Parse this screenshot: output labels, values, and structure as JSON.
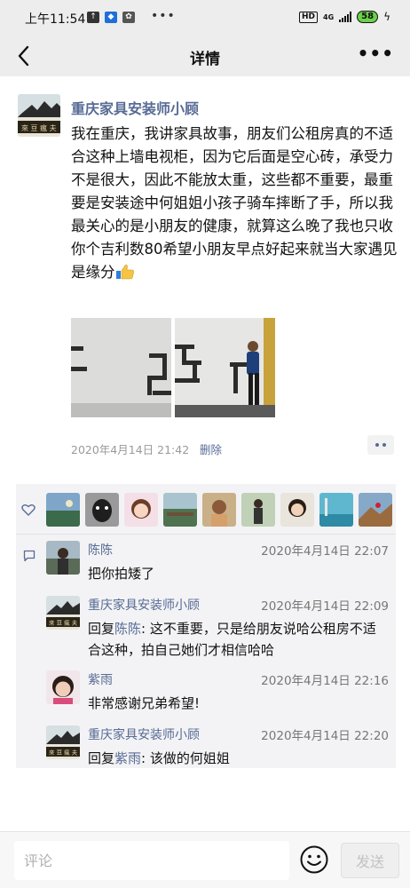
{
  "status_bar": {
    "time": "上午11:54",
    "hd": "HD",
    "network": "4G",
    "battery": "58"
  },
  "nav": {
    "title": "详情",
    "back_icon": "chevron-left-icon",
    "more_icon": "more-dots-icon"
  },
  "post": {
    "author": "重庆家具安装师小顾",
    "text": "我在重庆，我讲家具故事，朋友们公租房真的不适合这种上墙电视柜，因为它后面是空心砖，承受力不是很大，因此不能放太重，这些都不重要，最重要是安装途中何姐姐小孩子骑车摔断了手，所以我最关心的是小朋友的健康，就算这么晚了我也只收你个吉利数80希望小朋友早点好起来就当大家遇见是缘分",
    "emoji": "thumbs-up-icon",
    "time": "2020年4月14日 21:42",
    "delete_label": "删除"
  },
  "likes": {
    "icon": "heart-outline-icon",
    "count_avatars": 9
  },
  "comments": [
    {
      "name": "陈陈",
      "time": "2020年4月14日 22:07",
      "text": "把你拍矮了"
    },
    {
      "name": "重庆家具安装师小顾",
      "time": "2020年4月14日 22:09",
      "reply_prefix": "回复",
      "reply_to": "陈陈",
      "text": ": 这不重要，只是给朋友说哈公租房不适合这种，拍自己她们才相信哈哈"
    },
    {
      "name": "紫雨",
      "time": "2020年4月14日 22:16",
      "text": "非常感谢兄弟希望!"
    },
    {
      "name": "重庆家具安装师小顾",
      "time": "2020年4月14日 22:20",
      "reply_prefix": "回复",
      "reply_to": "紫雨",
      "text": ": 该做的何姐姐"
    }
  ],
  "bottom": {
    "placeholder": "评论",
    "send_label": "发送"
  },
  "colors": {
    "link": "#576b95",
    "panel_bg": "#f3f3f5",
    "header_bg": "#ededed"
  }
}
